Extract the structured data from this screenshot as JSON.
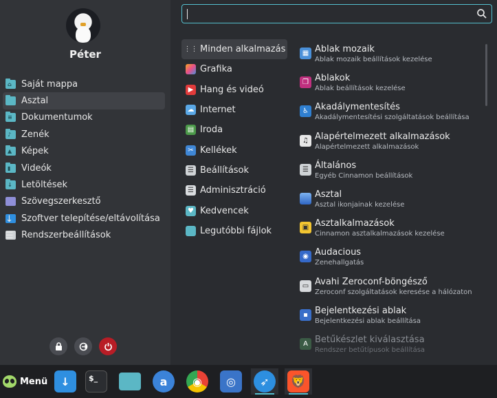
{
  "user": {
    "name": "Péter"
  },
  "places": [
    {
      "label": "Saját mappa",
      "icon": "home-folder-icon",
      "glyph": "⌂"
    },
    {
      "label": "Asztal",
      "icon": "desktop-folder-icon",
      "glyph": ""
    },
    {
      "label": "Dokumentumok",
      "icon": "documents-folder-icon",
      "glyph": "≡"
    },
    {
      "label": "Zenék",
      "icon": "music-folder-icon",
      "glyph": "♪"
    },
    {
      "label": "Képek",
      "icon": "pictures-folder-icon",
      "glyph": "▲"
    },
    {
      "label": "Videók",
      "icon": "videos-folder-icon",
      "glyph": "▮"
    },
    {
      "label": "Letöltések",
      "icon": "downloads-folder-icon",
      "glyph": "↓"
    },
    {
      "label": "Szövegszerkesztő",
      "icon": "text-editor-icon",
      "glyph": ""
    },
    {
      "label": "Szoftver telepítése/eltávolítása",
      "icon": "software-manager-icon",
      "glyph": "↓"
    },
    {
      "label": "Rendszerbeállítások",
      "icon": "system-settings-icon",
      "glyph": "☰"
    }
  ],
  "search": {
    "value": "",
    "placeholder": ""
  },
  "categories": [
    {
      "label": "Minden alkalmazás",
      "icon": "all-apps-grid-icon",
      "color": "#3d3f44",
      "glyph": "⋮⋮"
    },
    {
      "label": "Grafika",
      "icon": "graphics-icon",
      "color": "#e94f8a",
      "glyph": ""
    },
    {
      "label": "Hang és videó",
      "icon": "sound-video-icon",
      "color": "#e23b3b",
      "glyph": "▶"
    },
    {
      "label": "Internet",
      "icon": "internet-icon",
      "color": "#5aa8e6",
      "glyph": "☁"
    },
    {
      "label": "Iroda",
      "icon": "office-icon",
      "color": "#4c9a4a",
      "glyph": "▤"
    },
    {
      "label": "Kellékek",
      "icon": "accessories-icon",
      "color": "#3f87d6",
      "glyph": "✂"
    },
    {
      "label": "Beállítások",
      "icon": "preferences-icon",
      "color": "#cfd3d6",
      "glyph": "☰"
    },
    {
      "label": "Adminisztráció",
      "icon": "administration-icon",
      "color": "#d9dcdf",
      "glyph": "☰"
    },
    {
      "label": "Kedvencek",
      "icon": "favorites-folder-icon",
      "color": "#5bb7c5",
      "glyph": "♥"
    },
    {
      "label": "Legutóbbi fájlok",
      "icon": "recent-files-folder-icon",
      "color": "#5bb7c5",
      "glyph": ""
    }
  ],
  "apps": [
    {
      "name": "Ablak mozaik",
      "desc": "Ablak mozaik beállítások kezelése",
      "icon": "window-tiling-icon",
      "color": "#4a90d9",
      "glyph": "▦"
    },
    {
      "name": "Ablakok",
      "desc": "Ablak beállítások kezelése",
      "icon": "windows-icon",
      "color": "#c0307f",
      "glyph": "❐"
    },
    {
      "name": "Akadálymentesítés",
      "desc": "Akadálymentesítési szolgáltatások beállítása",
      "icon": "accessibility-icon",
      "color": "#2f7fd0",
      "glyph": "♿"
    },
    {
      "name": "Alapértelmezett alkalmazások",
      "desc": "Alapértelmezett alkalmazások",
      "icon": "default-apps-icon",
      "color": "#e8e8e8",
      "glyph": "♫"
    },
    {
      "name": "Általános",
      "desc": "Egyéb Cinnamon beállítások",
      "icon": "general-settings-icon",
      "color": "#cfd3d6",
      "glyph": "☰"
    },
    {
      "name": "Asztal",
      "desc": "Asztal ikonjainak kezelése",
      "icon": "desktop-icon",
      "color": "#3a7bd5",
      "glyph": ""
    },
    {
      "name": "Asztalkalmazások",
      "desc": "Cinnamon asztalkalmazások kezelése",
      "icon": "desklets-icon",
      "color": "#f2c531",
      "glyph": "▣"
    },
    {
      "name": "Audacious",
      "desc": "Zenehallgatás",
      "icon": "audacious-icon",
      "color": "#3569c9",
      "glyph": "◉"
    },
    {
      "name": "Avahi Zeroconf-böngésző",
      "desc": "Zeroconf szolgáltatások keresése a hálózaton",
      "icon": "avahi-browser-icon",
      "color": "#d8dadd",
      "glyph": "▭"
    },
    {
      "name": "Bejelentkezési ablak",
      "desc": "Bejelentkezési ablak beállítása",
      "icon": "login-window-icon",
      "color": "#3a6fc9",
      "glyph": "▪"
    },
    {
      "name": "Betűkészlet kiválasztása",
      "desc": "Rendszer betűtípusok beállítása",
      "icon": "font-selection-icon",
      "color": "#3b5b45",
      "glyph": "A"
    }
  ],
  "taskbar": {
    "menu_label": "Menü",
    "launchers": [
      {
        "name": "software-manager-icon",
        "color": "#2f8fe0",
        "glyph": "↓",
        "running": false
      },
      {
        "name": "terminal-icon",
        "color": "#2b2d31",
        "glyph": "$_",
        "running": false
      },
      {
        "name": "files-icon",
        "color": "#5bb7c5",
        "glyph": "",
        "running": false
      },
      {
        "name": "app-center-icon",
        "color": "#3b83d9",
        "glyph": "a",
        "running": false
      },
      {
        "name": "chrome-icon",
        "color": "#d9dde1",
        "glyph": "◉",
        "running": false
      },
      {
        "name": "screenshot-icon",
        "color": "#3a74c8",
        "glyph": "◎",
        "running": false
      },
      {
        "name": "browser-icon",
        "color": "#2d8fe0",
        "glyph": "➶",
        "running": true
      },
      {
        "name": "brave-icon",
        "color": "#fb542b",
        "glyph": "🦁",
        "running": true
      }
    ]
  }
}
